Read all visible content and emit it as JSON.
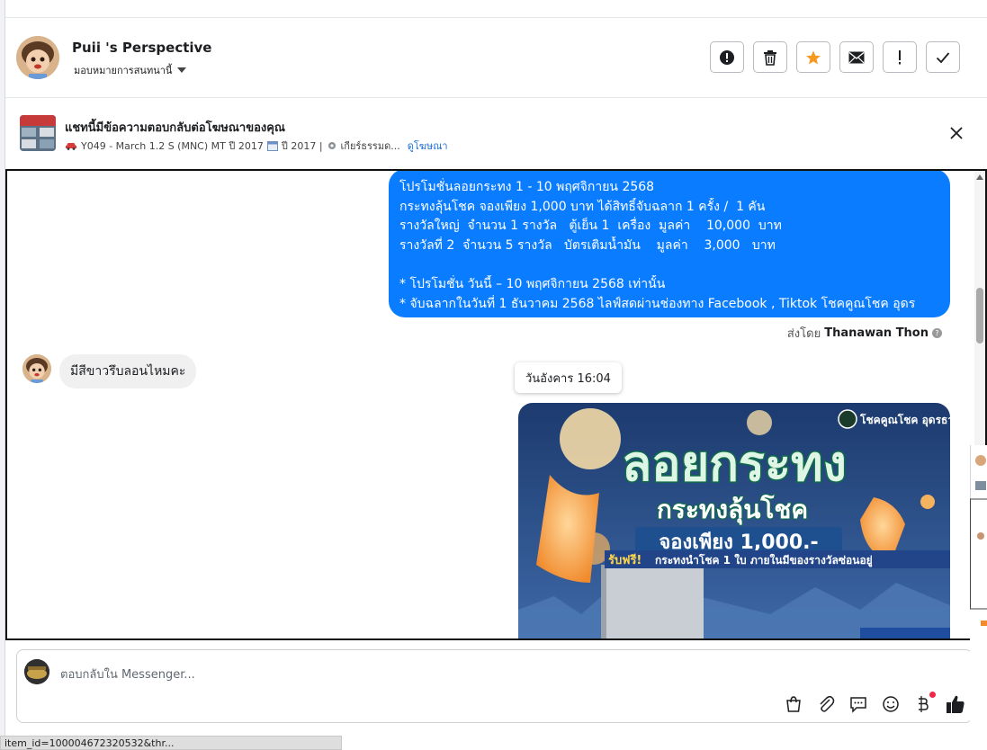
{
  "header": {
    "name": "Puii 's Perspective",
    "assign_label": "มอบหมายการสนทนานี้"
  },
  "ad_banner": {
    "title": "แชทนี้มีข้อความตอบกลับต่อโฆษณาของคุณ",
    "subtitle_1": "Y049 - March 1.2 S (MNC) MT ปี 2017",
    "subtitle_2": "ปี 2017 |",
    "subtitle_3": "เกียร์ธรรมด...",
    "link": "ดูโฆษณา"
  },
  "outgoing_message": {
    "lines": [
      "โปรโมชั่นลอยกระทง 1 - 10 พฤศจิกายน 2568",
      "กระทงลุ้นโชค จองเพียง 1,000 บาท ได้สิทธิ์จับฉลาก 1 ครั้ง /  1 คัน",
      "รางวัลใหญ่  จำนวน 1 รางวัล   ตู้เย็น 1  เครื่อง  มูลค่า    10,000  บาท",
      "รางวัลที่ 2  จำนวน 5 รางวัล   บัตรเติมน้ำมัน    มูลค่า    3,000   บาท",
      "",
      "* โปรโมชั่น วันนี้ – 10 พฤศจิกายน 2568 เท่านั้น",
      "* จับฉลากในวันที่ 1 ธันวาคม 2568 ไลฟ์สดผ่านช่องทาง Facebook , Tiktok โชคคูณโชค อุดร"
    ],
    "sent_by_label": "ส่งโดย",
    "sent_by_name": "Thanawan Thon"
  },
  "incoming_message": {
    "text": "มีสีขาวรึบลอนไหมคะ"
  },
  "timestamp": "วันอังคาร 16:04",
  "promo_image": {
    "brand": "โชคคูณโชค อุดรธานี",
    "headline": "ลอยกระทง",
    "line2": "กระทงลุ้นโชค",
    "line3": "จองเพียง 1,000.-",
    "free_badge": "รับฟรี!",
    "line4": "กระทงนำโชค 1 ใบ ภายในมีของรางวัลซ่อนอยู่"
  },
  "composer": {
    "placeholder": "ตอบกลับใน Messenger..."
  },
  "status_bar": "item_id=100004672320532&thr..."
}
